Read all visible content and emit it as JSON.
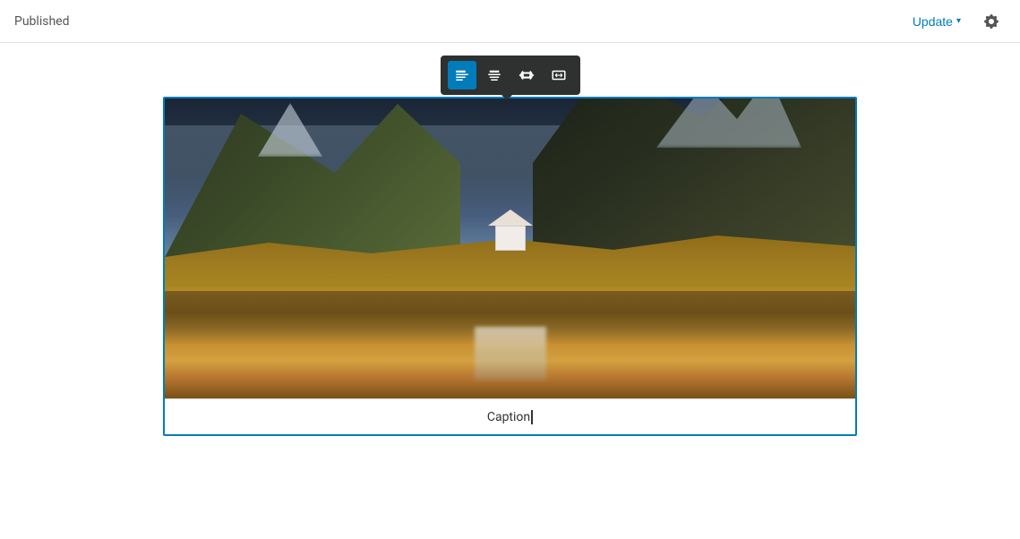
{
  "header": {
    "status_label": "Published",
    "update_button_label": "Update",
    "update_chevron": "▾"
  },
  "toolbar": {
    "buttons": [
      {
        "id": "align-left",
        "label": "Align left",
        "active": true,
        "icon": "align-left-icon"
      },
      {
        "id": "align-center",
        "label": "Align center",
        "active": false,
        "icon": "align-center-icon"
      },
      {
        "id": "wide-width",
        "label": "Wide width",
        "active": false,
        "icon": "wide-width-icon"
      },
      {
        "id": "full-width",
        "label": "Full width",
        "active": false,
        "icon": "full-width-icon"
      }
    ]
  },
  "image_block": {
    "caption_placeholder": "Caption",
    "caption_value": "Caption"
  },
  "colors": {
    "accent": "#007cba",
    "toolbar_bg": "#2f3030",
    "border": "#007cba"
  }
}
